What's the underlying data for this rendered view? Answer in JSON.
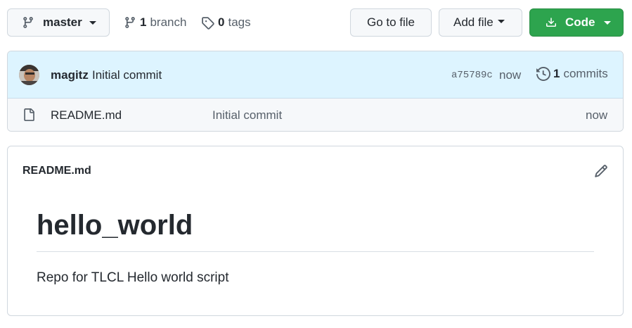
{
  "toolbar": {
    "branch_selector": {
      "label": "master",
      "icon": "git-branch-icon"
    },
    "branch_count": {
      "count": "1",
      "label": "branch",
      "icon": "git-branch-icon"
    },
    "tag_count": {
      "count": "0",
      "label": "tags",
      "icon": "tag-icon"
    },
    "go_to_file_label": "Go to file",
    "add_file_label": "Add file",
    "code_label": "Code",
    "code_button_color": "#2da44e"
  },
  "latest_commit": {
    "author": "magitz",
    "message": "Initial commit",
    "sha": "a75789c",
    "time": "now",
    "commits_count": "1",
    "commits_label": "commits",
    "header_bg": "#ddf4ff"
  },
  "files": [
    {
      "icon": "file-icon",
      "name": "README.md",
      "message": "Initial commit",
      "time": "now"
    }
  ],
  "readme": {
    "filename": "README.md",
    "heading": "hello_world",
    "body": "Repo for TLCL Hello world script"
  }
}
